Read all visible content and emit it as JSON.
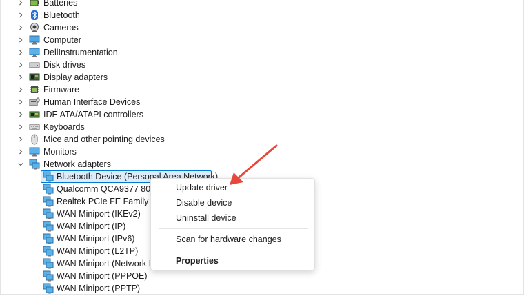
{
  "tree": {
    "categories": [
      {
        "label": "Batteries",
        "icon": "battery-icon",
        "expanded": false
      },
      {
        "label": "Bluetooth",
        "icon": "bluetooth-icon",
        "expanded": false
      },
      {
        "label": "Cameras",
        "icon": "camera-icon",
        "expanded": false
      },
      {
        "label": "Computer",
        "icon": "computer-icon",
        "expanded": false
      },
      {
        "label": "DellInstrumentation",
        "icon": "monitor-icon",
        "expanded": false
      },
      {
        "label": "Disk drives",
        "icon": "disk-drive-icon",
        "expanded": false
      },
      {
        "label": "Display adapters",
        "icon": "display-adapter-icon",
        "expanded": false
      },
      {
        "label": "Firmware",
        "icon": "firmware-icon",
        "expanded": false
      },
      {
        "label": "Human Interface Devices",
        "icon": "hid-icon",
        "expanded": false
      },
      {
        "label": "IDE ATA/ATAPI controllers",
        "icon": "ide-controller-icon",
        "expanded": false
      },
      {
        "label": "Keyboards",
        "icon": "keyboard-icon",
        "expanded": false
      },
      {
        "label": "Mice and other pointing devices",
        "icon": "mouse-icon",
        "expanded": false
      },
      {
        "label": "Monitors",
        "icon": "monitor-icon",
        "expanded": false
      },
      {
        "label": "Network adapters",
        "icon": "network-adapter-icon",
        "expanded": true
      }
    ],
    "network_adapters": [
      {
        "label": "Bluetooth Device (Personal Area Network)",
        "selected": true
      },
      {
        "label": "Qualcomm QCA9377 802"
      },
      {
        "label": "Realtek PCIe FE Family Co"
      },
      {
        "label": "WAN Miniport (IKEv2)"
      },
      {
        "label": "WAN Miniport (IP)"
      },
      {
        "label": "WAN Miniport (IPv6)"
      },
      {
        "label": "WAN Miniport (L2TP)"
      },
      {
        "label": "WAN Miniport (Network I"
      },
      {
        "label": "WAN Miniport (PPPOE)"
      },
      {
        "label": "WAN Miniport (PPTP)"
      }
    ]
  },
  "context_menu": {
    "update_driver": "Update driver",
    "disable_device": "Disable device",
    "uninstall_device": "Uninstall device",
    "scan_hardware": "Scan for hardware changes",
    "properties": "Properties"
  },
  "colors": {
    "selection_border": "#0078d4",
    "selection_fill": "#dcecfb",
    "arrow": "#e8483c",
    "network_icon": "#2b8fd6"
  }
}
